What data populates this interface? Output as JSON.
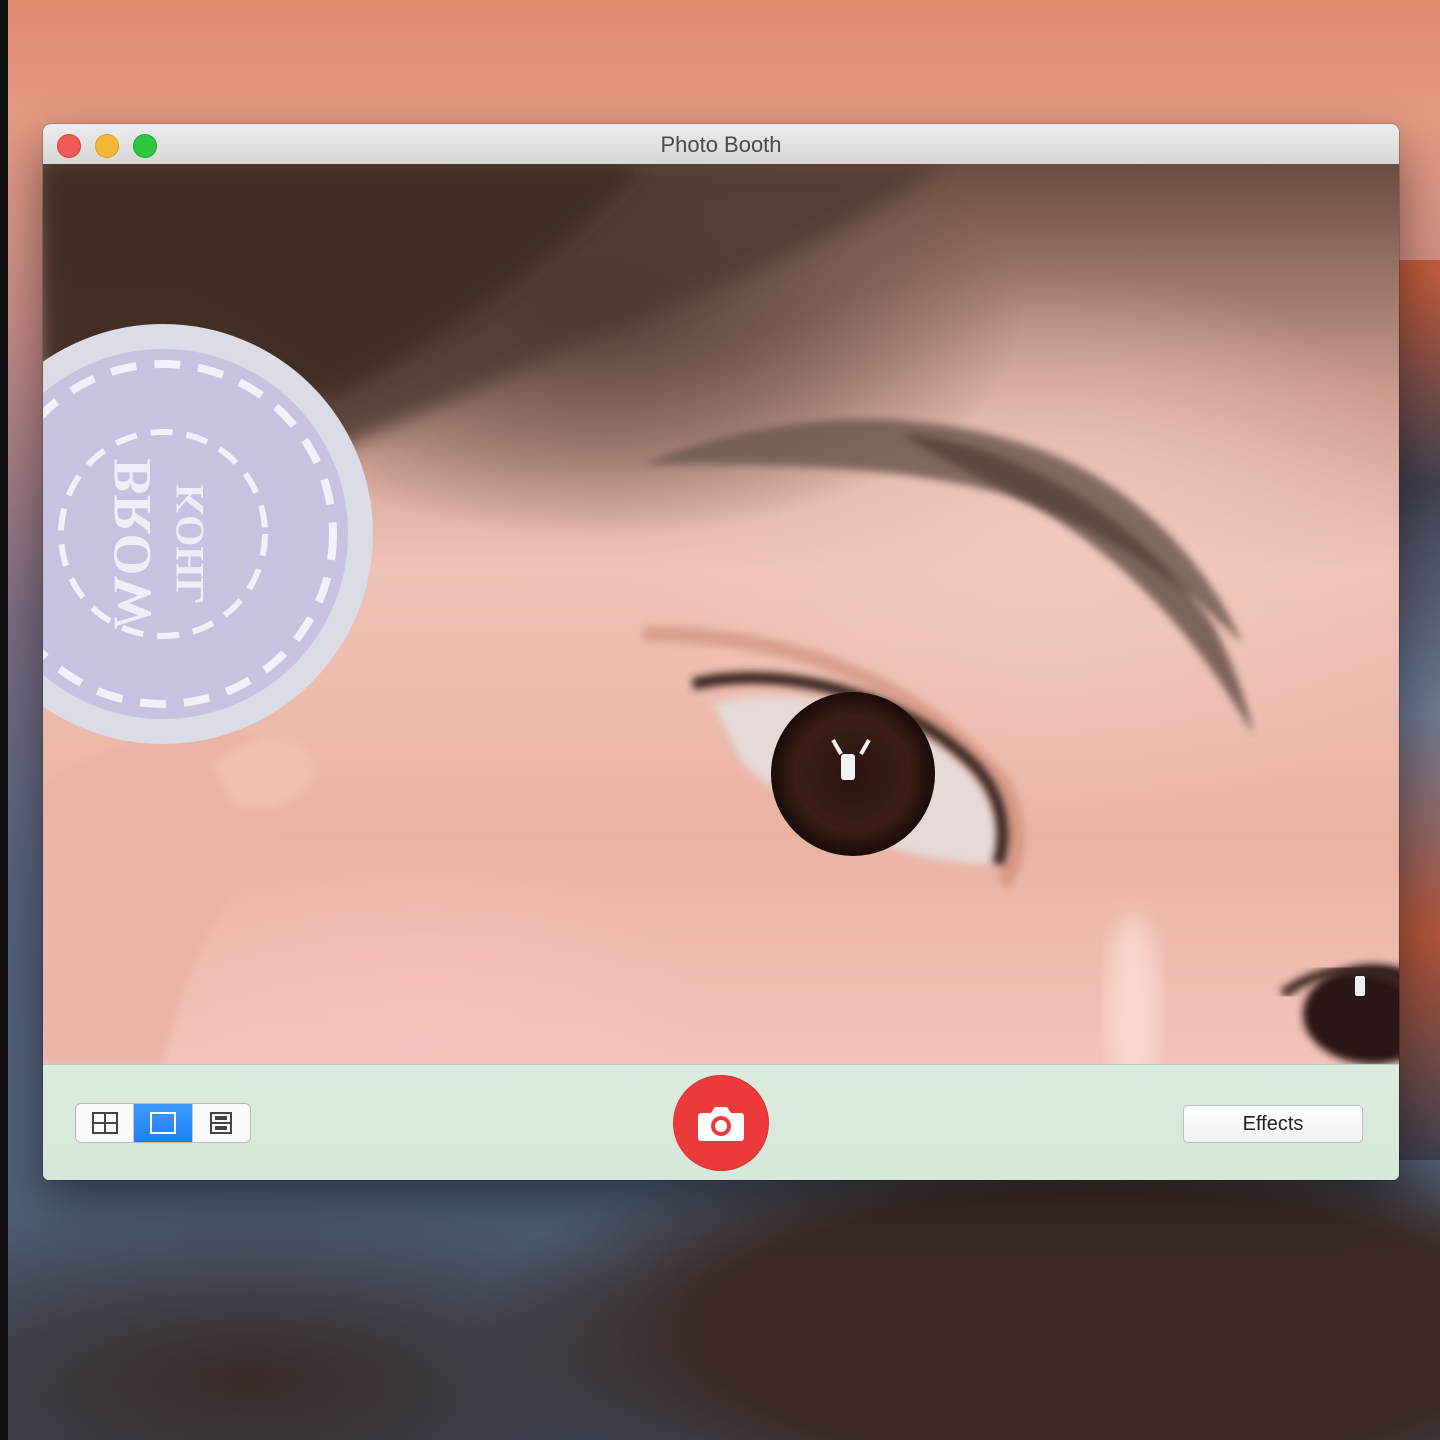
{
  "window": {
    "title": "Photo Booth"
  },
  "toolbar": {
    "view_modes": [
      {
        "name": "four-up",
        "icon": "grid-icon",
        "active": false
      },
      {
        "name": "single",
        "icon": "single-frame-icon",
        "active": true
      },
      {
        "name": "filmstrip",
        "icon": "filmstrip-icon",
        "active": false
      }
    ],
    "shutter_icon": "camera-icon",
    "effects_label": "Effects"
  },
  "preview": {
    "sticker_text_line1": "BROW",
    "sticker_text_line2": "KOHL"
  },
  "colors": {
    "shutter": "#ec3a3a",
    "active_segment": "#2d8cff",
    "toolbar": "#dcece0"
  }
}
